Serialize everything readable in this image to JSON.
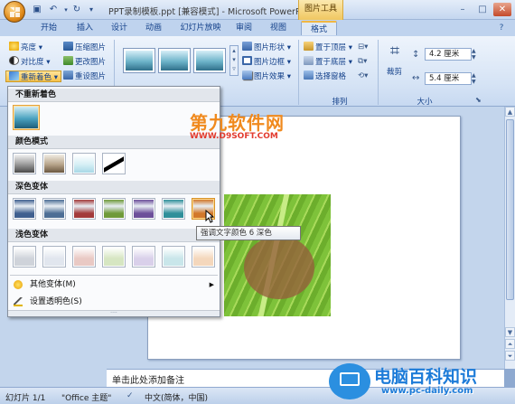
{
  "titlebar": {
    "doc_title": "PPT录制模板.ppt [兼容模式] - Microsoft PowerP...",
    "context_tab": "图片工具",
    "minimize": "–",
    "maximize": "□",
    "close": "✕"
  },
  "tabs": [
    {
      "label": "开始"
    },
    {
      "label": "插入"
    },
    {
      "label": "设计"
    },
    {
      "label": "动画"
    },
    {
      "label": "幻灯片放映"
    },
    {
      "label": "审阅"
    },
    {
      "label": "视图"
    },
    {
      "label": "格式",
      "active": true
    }
  ],
  "ribbon": {
    "adjust": {
      "brightness": "亮度",
      "contrast": "对比度",
      "recolor": "重新着色",
      "compress": "压缩图片",
      "change": "更改图片",
      "reset": "重设图片"
    },
    "picture_style": {
      "shape": "图片形状",
      "border": "图片边框",
      "effects": "图片效果"
    },
    "arrange": {
      "bring_front": "置于顶层",
      "send_back": "置于底层",
      "selection_pane": "选择窗格",
      "label": "排列"
    },
    "size": {
      "crop": "裁剪",
      "height": "4.2 厘米",
      "width": "5.4 厘米",
      "label": "大小"
    }
  },
  "recolor_menu": {
    "no_recolor": "不重新着色",
    "color_modes": "颜色模式",
    "dark_variations": "深色变体",
    "light_variations": "浅色变体",
    "more_variations": "其他变体(M)",
    "set_transparent": "设置透明色(S)",
    "tooltip": "强调文字颜色 6 深色",
    "dark_colors": [
      "#3f5f8f",
      "#4d6e95",
      "#a33b3b",
      "#6f9a3a",
      "#6c4f9a",
      "#2f8f9a",
      "#d2782a"
    ],
    "light_colors": [
      "#cfd3da",
      "#e1e6ee",
      "#e9c9c4",
      "#d6e6c2",
      "#d9d0ea",
      "#c9e6ea",
      "#f4d7bc"
    ]
  },
  "notes": {
    "placeholder": "单击此处添加备注"
  },
  "statusbar": {
    "slide": "幻灯片 1/1",
    "theme": "\"Office 主题\"",
    "language": "中文(简体，中国)"
  },
  "watermarks": {
    "top_cn": "第九软件网",
    "top_url": "WWW.D9SOFT.COM",
    "bottom_cn": "电脑百科知识",
    "bottom_url": "www.pc-daily.com"
  }
}
